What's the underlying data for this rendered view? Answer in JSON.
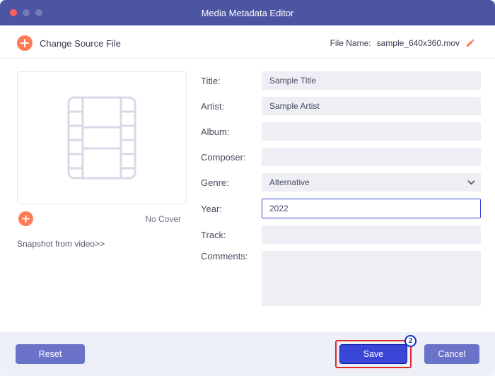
{
  "window": {
    "title": "Media Metadata Editor"
  },
  "header": {
    "change_source_label": "Change Source File",
    "file_name_label": "File Name:",
    "file_name_value": "sample_640x360.mov"
  },
  "cover": {
    "no_cover_label": "No Cover",
    "snapshot_link": "Snapshot from video>>"
  },
  "fields": {
    "title_label": "Title:",
    "title_value": "Sample Title",
    "artist_label": "Artist:",
    "artist_value": "Sample Artist",
    "album_label": "Album:",
    "album_value": "",
    "composer_label": "Composer:",
    "composer_value": "",
    "genre_label": "Genre:",
    "genre_value": "Alternative",
    "year_label": "Year:",
    "year_value": "2022",
    "track_label": "Track:",
    "track_value": "",
    "comments_label": "Comments:",
    "comments_value": ""
  },
  "footer": {
    "reset_label": "Reset",
    "save_label": "Save",
    "cancel_label": "Cancel",
    "annotation_badge": "2"
  },
  "colors": {
    "primary": "#4b55a2",
    "accent": "#ff7b54",
    "button_blue": "#3a46d6",
    "highlight_red": "#e02828"
  }
}
